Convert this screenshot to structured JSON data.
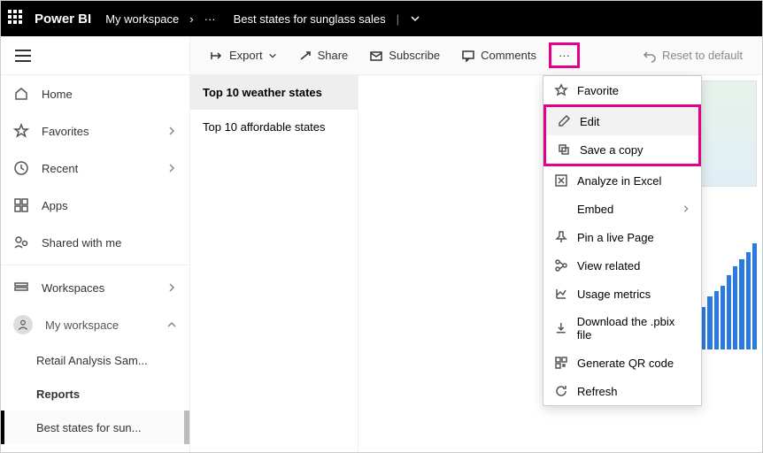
{
  "header": {
    "brand": "Power BI",
    "breadcrumb1": "My workspace",
    "breadcrumb_more": "···",
    "report_title": "Best states for sunglass sales"
  },
  "sidebar": {
    "items": [
      {
        "label": "Home"
      },
      {
        "label": "Favorites"
      },
      {
        "label": "Recent"
      },
      {
        "label": "Apps"
      },
      {
        "label": "Shared with me"
      }
    ],
    "workspaces_label": "Workspaces",
    "my_workspace_label": "My workspace",
    "sub": [
      {
        "label": "Retail Analysis Sam..."
      },
      {
        "label": "Reports"
      },
      {
        "label": "Best states for sun..."
      }
    ]
  },
  "toolbar": {
    "export": "Export",
    "share": "Share",
    "subscribe": "Subscribe",
    "comments": "Comments",
    "reset": "Reset to default"
  },
  "page_tabs": [
    "Top 10 weather states",
    "Top 10 affordable states"
  ],
  "dropdown": {
    "favorite": "Favorite",
    "edit": "Edit",
    "save_copy": "Save a copy",
    "analyze_excel": "Analyze in Excel",
    "embed": "Embed",
    "pin_live": "Pin a live Page",
    "view_related": "View related",
    "usage_metrics": "Usage metrics",
    "download_pbix": "Download the .pbix file",
    "generate_qr": "Generate QR code",
    "refresh": "Refresh"
  }
}
